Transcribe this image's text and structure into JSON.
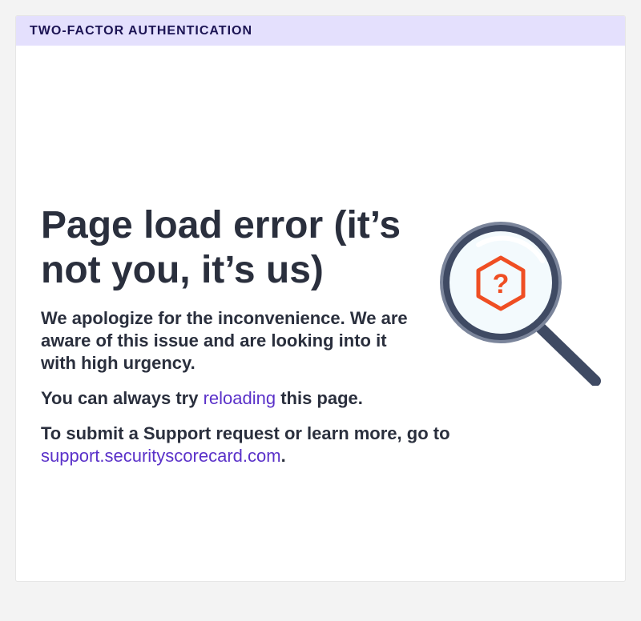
{
  "header": {
    "title": "TWO-FACTOR AUTHENTICATION"
  },
  "error": {
    "title": "Page load error (it’s not you, it’s us)",
    "apology": "We apologize for the inconvenience. We are aware of this issue and are looking into it with high urgency.",
    "retry_prefix": "You can always try ",
    "retry_link": "reloading",
    "retry_suffix": " this page.",
    "support_prefix": "To submit a Support request or learn more, go to ",
    "support_link": "support.securityscorecard.com",
    "support_suffix": "."
  },
  "illustration": {
    "icon": "magnifier-question-icon",
    "glyph": "?"
  },
  "colors": {
    "header_bg": "#e4e0fd",
    "header_text": "#1c1454",
    "link": "#5a31c9",
    "text": "#2a2f3d",
    "accent": "#ef4e23",
    "lens_frame": "#3f4a63"
  }
}
